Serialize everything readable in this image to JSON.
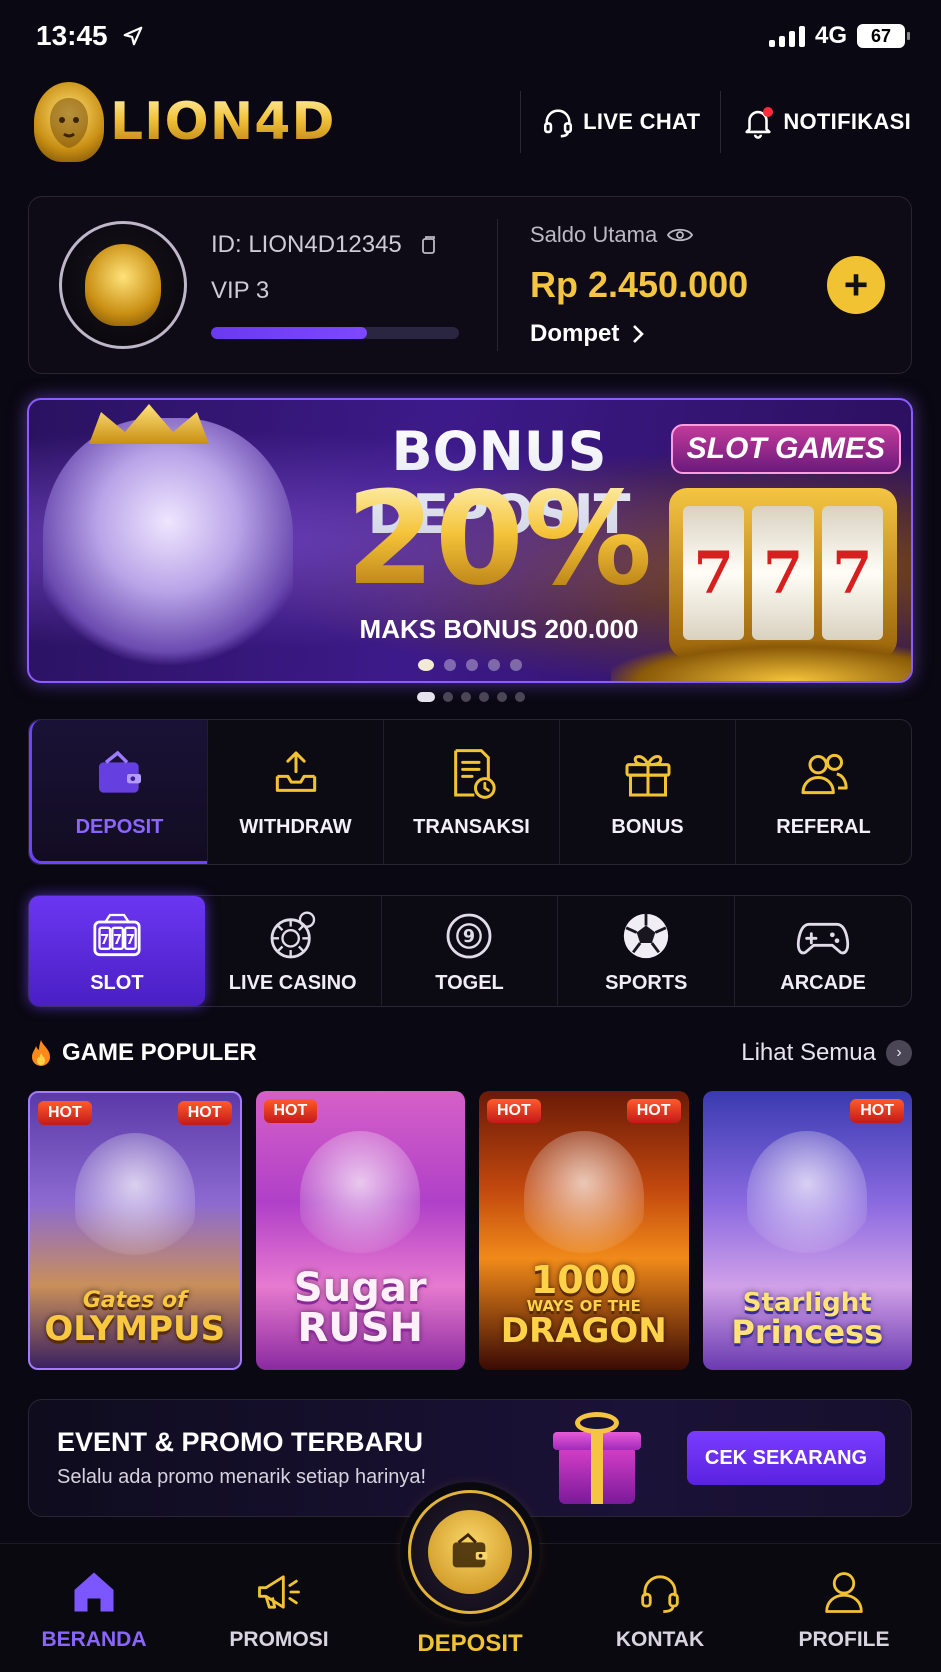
{
  "status": {
    "time": "13:45",
    "network": "4G",
    "battery": "67"
  },
  "header": {
    "logo_text": "LION4D",
    "live_chat_label": "LIVE CHAT",
    "notification_label": "NOTIFIKASI"
  },
  "profile": {
    "id_text": "ID: LION4D12345",
    "vip_text": "VIP 3",
    "vip_progress": 0.63,
    "balance_label": "Saldo Utama",
    "balance_amount": "Rp 2.450.000",
    "wallet_link": "Dompet"
  },
  "banner": {
    "title": "BONUS DEPOSIT",
    "percent": "20%",
    "subtitle": "MAKS BONUS 200.000",
    "tag": "SLOT GAMES",
    "reels": [
      "7",
      "7",
      "7"
    ],
    "slides_total": 5,
    "active_slide": 1
  },
  "quick_actions": [
    {
      "label": "DEPOSIT",
      "icon": "wallet-icon",
      "active": true
    },
    {
      "label": "WITHDRAW",
      "icon": "upload-tray-icon",
      "active": false
    },
    {
      "label": "TRANSAKSI",
      "icon": "receipt-clock-icon",
      "active": false
    },
    {
      "label": "BONUS",
      "icon": "gift-icon",
      "active": false
    },
    {
      "label": "REFERAL",
      "icon": "users-icon",
      "active": false
    }
  ],
  "categories": [
    {
      "label": "SLOT",
      "icon": "slot-777-icon",
      "active": true
    },
    {
      "label": "LIVE CASINO",
      "icon": "roulette-chip-icon",
      "active": false
    },
    {
      "label": "TOGEL",
      "icon": "lottery-ball-9-icon",
      "active": false
    },
    {
      "label": "SPORTS",
      "icon": "soccer-ball-icon",
      "active": false
    },
    {
      "label": "ARCADE",
      "icon": "gamepad-icon",
      "active": false
    }
  ],
  "popular": {
    "title": "GAME POPULER",
    "see_all": "Lihat Semua",
    "games": [
      {
        "title_line1": "Gates of",
        "title_line2": "OLYMPUS",
        "badge": "HOT"
      },
      {
        "title_line1": "Sugar",
        "title_line2": "RUSH",
        "badge": "HOT"
      },
      {
        "title_line1": "1000",
        "title_sub": "WAYS OF THE",
        "title_line2": "DRAGON",
        "badge": "HOT"
      },
      {
        "title_line1": "Starlight",
        "title_line2": "Princess",
        "badge": "HOT"
      }
    ]
  },
  "promo": {
    "title": "EVENT & PROMO TERBARU",
    "subtitle": "Selalu ada promo menarik setiap harinya!",
    "cta": "CEK SEKARANG"
  },
  "bottom_nav": {
    "home": "BERANDA",
    "promo": "PROMOSI",
    "deposit": "DEPOSIT",
    "contact": "KONTAK",
    "profile": "PROFILE"
  },
  "colors": {
    "background": "#0a0812",
    "accent_purple": "#6d43ff",
    "accent_gold": "#f1c232"
  }
}
